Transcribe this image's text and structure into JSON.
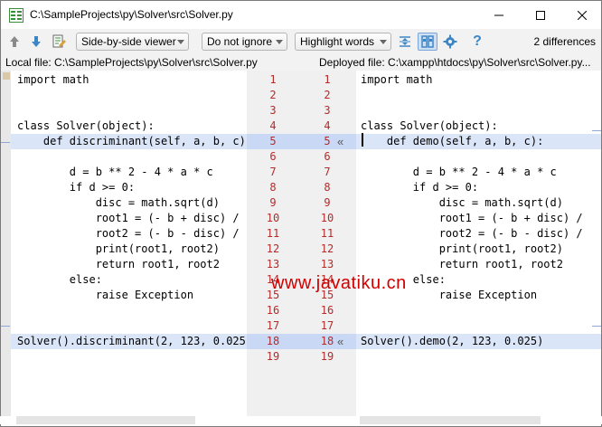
{
  "window": {
    "title": "C:\\SampleProjects\\py\\Solver\\src\\Solver.py",
    "minimize_glyph": "—",
    "maximize_glyph": "☐",
    "close_glyph": "✕"
  },
  "toolbar": {
    "viewer_mode": "Side-by-side viewer",
    "whitespace_mode": "Do not ignore",
    "highlight_mode": "Highlight words",
    "differences_count": "2 differences",
    "icons": [
      "previous-diff-icon",
      "next-diff-icon",
      "edit-source-icon",
      "collapse-unchanged-icon",
      "sync-scroll-icon",
      "settings-icon",
      "help-icon"
    ],
    "help_glyph": "?"
  },
  "files": {
    "left_label": "Local file: C:\\SampleProjects\\py\\Solver\\src\\Solver.py",
    "right_label": "Deployed file: C:\\xampp\\htdocs\\py\\Solver\\src\\Solver.py..."
  },
  "left_lines": [
    "import math",
    "",
    "",
    "class Solver(object):",
    "    def discriminant(self, a, b, c):",
    "",
    "        d = b ** 2 - 4 * a * c",
    "        if d >= 0:",
    "            disc = math.sqrt(d)",
    "            root1 = (- b + disc) /",
    "            root2 = (- b - disc) /",
    "            print(root1, root2)",
    "            return root1, root2",
    "        else:",
    "            raise Exception",
    "",
    "",
    "Solver().discriminant(2, 123, 0.025)",
    ""
  ],
  "right_lines": [
    "import math",
    "",
    "",
    "class Solver(object):",
    "    def demo(self, a, b, c):",
    "",
    "        d = b ** 2 - 4 * a * c",
    "        if d >= 0:",
    "            disc = math.sqrt(d)",
    "            root1 = (- b + disc) /",
    "            root2 = (- b - disc) /",
    "            print(root1, root2)",
    "            return root1, root2",
    "        else:",
    "            raise Exception",
    "",
    "",
    "Solver().demo(2, 123, 0.025)",
    ""
  ],
  "line_numbers": [
    "1",
    "2",
    "3",
    "4",
    "5",
    "6",
    "7",
    "8",
    "9",
    "10",
    "11",
    "12",
    "13",
    "14",
    "15",
    "16",
    "17",
    "18",
    "19"
  ],
  "changed_lines": [
    5,
    18
  ],
  "chevron": "«",
  "watermark": "www.javatiku.cn",
  "colors": {
    "changed_bg": "#dbe5f8",
    "gutter_changed_bg": "#c9d8f5",
    "line_number": "#b52b2b",
    "keyword": "#000080"
  }
}
